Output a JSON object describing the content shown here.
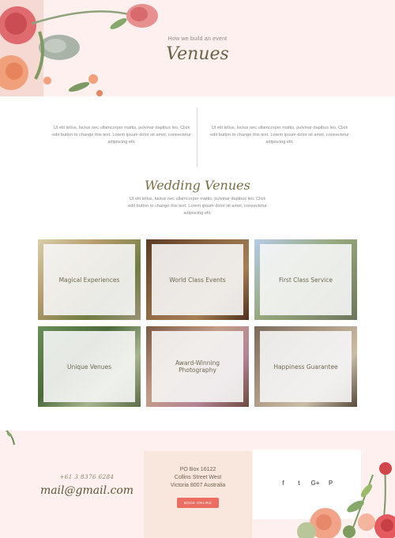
{
  "hero": {
    "pretitle": "How we build an event",
    "title": "Venues"
  },
  "intro": {
    "left": "Ut elit tellus, luctus nec ullamcorper mattis, pulvinar dapibus leo. Click edit button to change this text. Lorem ipsum dolor sit amet, consectetur adipiscing elit.",
    "right": "Ut elit tellus, luctus nec ullamcorper mattis, pulvinar dapibus leo. Click edit button to change this text. Lorem ipsum dolor sit amet, consectetur adipiscing elit."
  },
  "section": {
    "title": "Wedding Venues",
    "text": "Ut elit tellus, luctus nec ullamcorper mattis, pulvinar dapibus leo. Click edit button to change this text. Lorem ipsum dolor sit amet, consectetur adipiscing elit."
  },
  "tiles": [
    {
      "label": "Magical Experiences"
    },
    {
      "label": "World Class Events"
    },
    {
      "label": "First Class Service"
    },
    {
      "label": "Unique Venues"
    },
    {
      "label": "Award-Winning Photography"
    },
    {
      "label": "Happiness Guarantee"
    }
  ],
  "footer": {
    "phone": "+61 3 8376 6284",
    "email": "mail@gmail.com",
    "address": [
      "PO Box 16122",
      "Collins Street West",
      "Victoria 8007 Australia"
    ],
    "button": "BOOK ONLINE",
    "social": [
      {
        "icon": "facebook-icon",
        "glyph": "f"
      },
      {
        "icon": "twitter-icon",
        "glyph": "t"
      },
      {
        "icon": "google-plus-icon",
        "glyph": "G+"
      },
      {
        "icon": "pinterest-icon",
        "glyph": "P"
      }
    ]
  },
  "colors": {
    "background_blush": "#fdf0ee",
    "accent_coral": "#ec6e62",
    "title_olive": "#6d6247"
  }
}
